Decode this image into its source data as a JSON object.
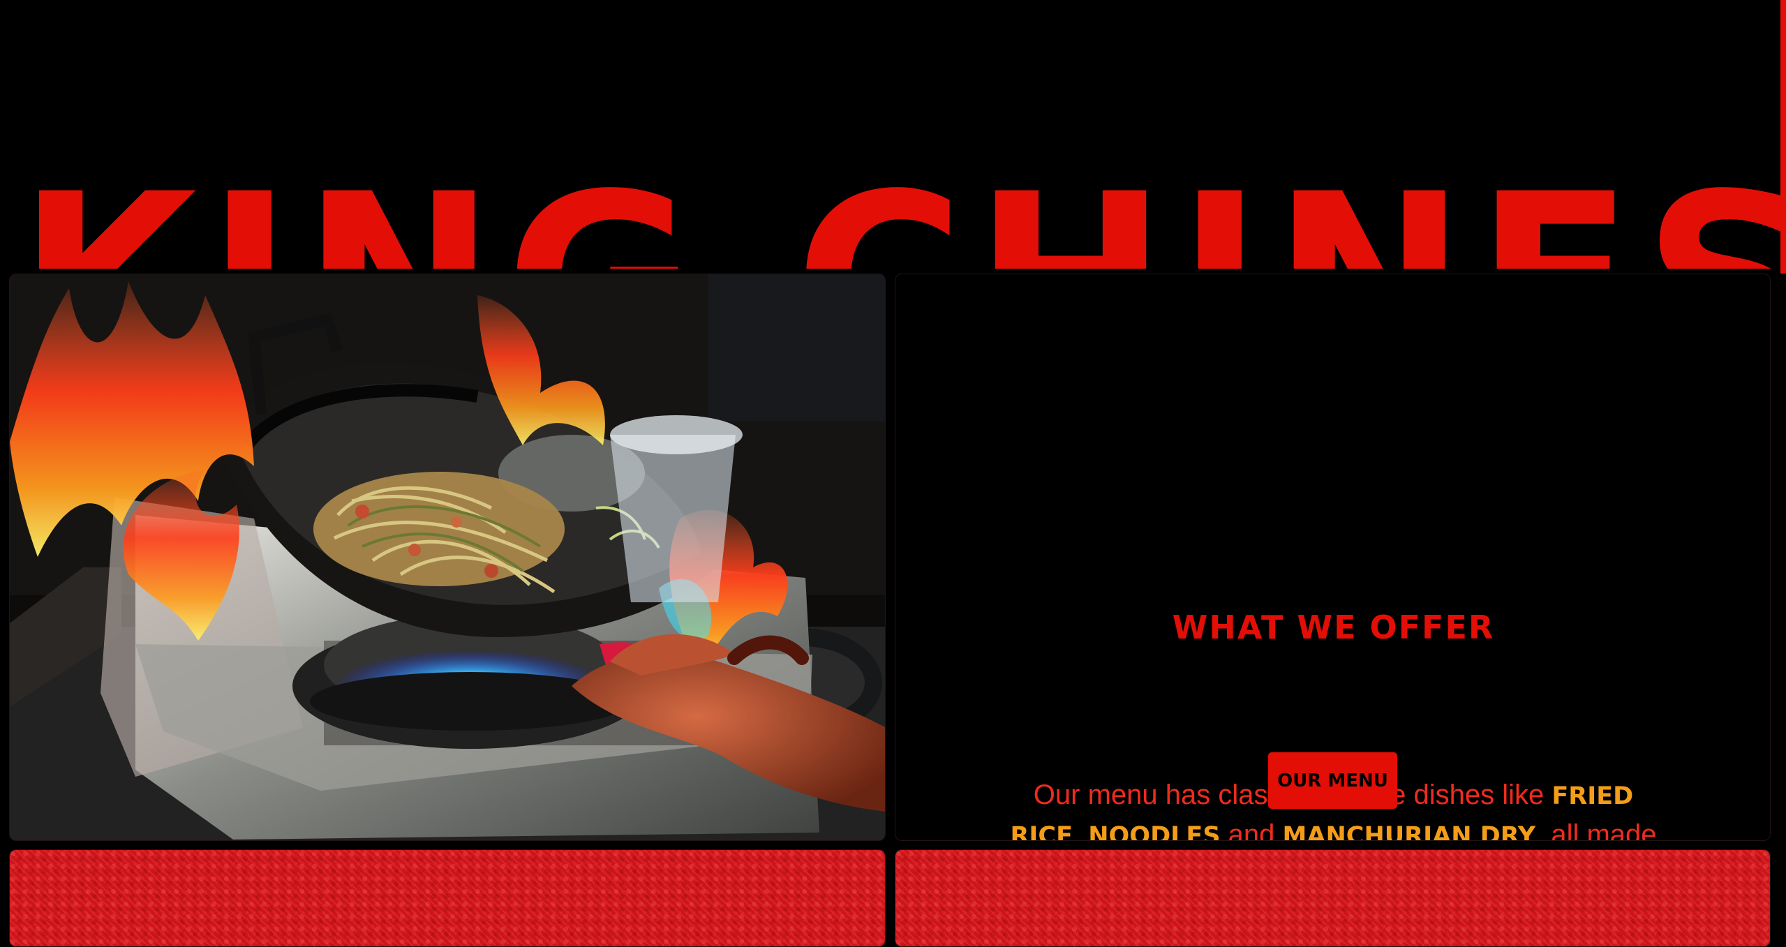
{
  "page": {
    "title": "KING CHINESE"
  },
  "offer": {
    "heading": "WHAT WE OFFER",
    "text_prefix": "Our menu has classic chinese dishes like",
    "dishes": [
      "FRIED RICE",
      "NOODLES",
      "MANCHURIAN DRY"
    ],
    "text_join_1": ",",
    "text_join_2": "and",
    "text_suffix": ", all made with fresh ingredients, traditional recipes at budget friendly price.",
    "button_label": "OUR MENU"
  },
  "colors": {
    "brand_red": "#e30f06",
    "accent_orange": "#f39d18",
    "background": "#000000"
  },
  "images": {
    "hero_photo": "wok-with-noodles-over-fire",
    "bottom_panels": "red-textured-fabric"
  }
}
